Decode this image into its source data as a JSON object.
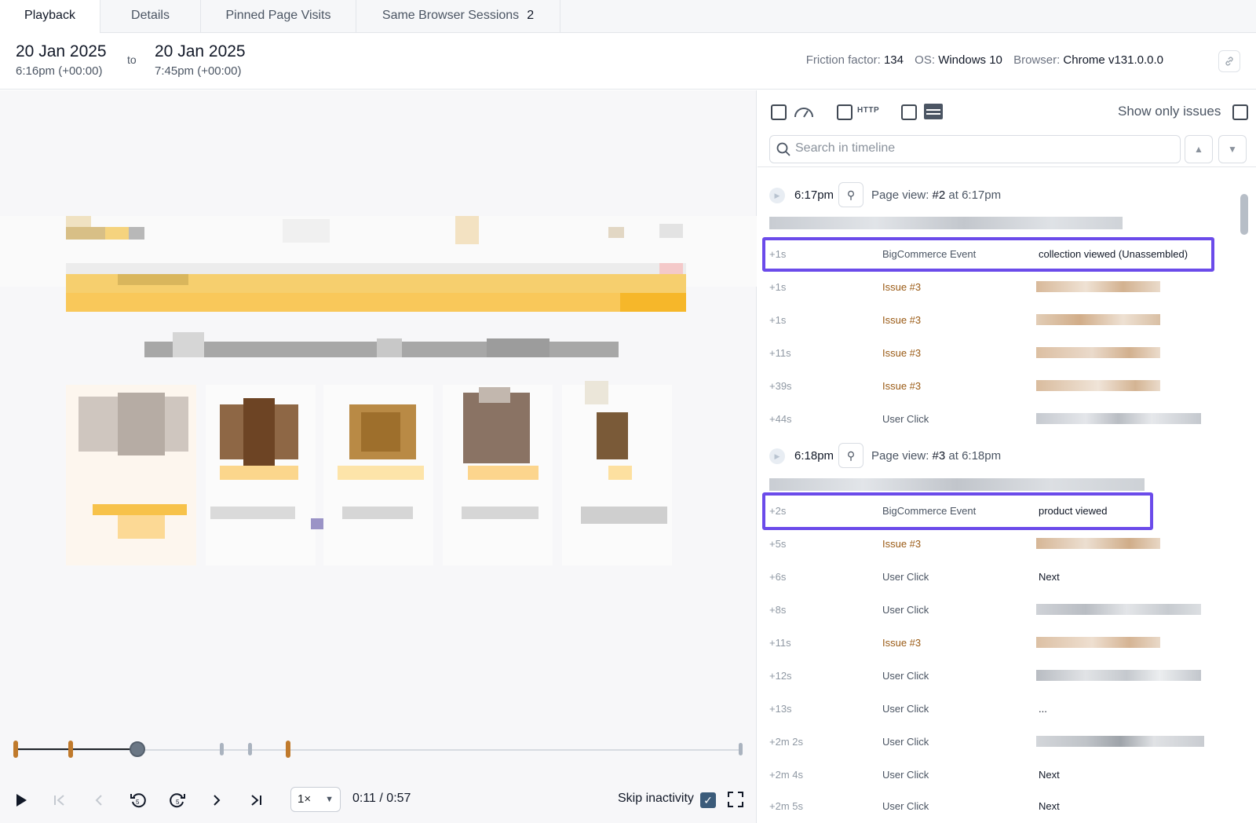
{
  "tabs": [
    {
      "label": "Playback"
    },
    {
      "label": "Details"
    },
    {
      "label": "Pinned Page Visits"
    },
    {
      "label": "Same Browser Sessions",
      "count": "2"
    }
  ],
  "header": {
    "start_date": "20 Jan 2025",
    "start_time": "6:16pm (+00:00)",
    "to": "to",
    "end_date": "20 Jan 2025",
    "end_time": "7:45pm (+00:00)",
    "friction_label": "Friction factor:",
    "friction_value": "134",
    "os_label": "OS:",
    "os_value": "Windows 10",
    "browser_label": "Browser:",
    "browser_value": "Chrome v131.0.0.0"
  },
  "player": {
    "speed": "1×",
    "time": "0:11 / 0:57",
    "skip_inactivity_label": "Skip inactivity",
    "skip_inactivity": true,
    "progress": 0.16
  },
  "panel": {
    "http_label": "HTTP",
    "show_only_issues_label": "Show only issues",
    "search_placeholder": "Search in timeline",
    "page_views": [
      {
        "time": "6:17pm",
        "title": "Page view:",
        "number": "#2",
        "at": "at 6:17pm",
        "rows": [
          {
            "offset": "+1s",
            "type": "BigCommerce Event",
            "value": "collection viewed (Unassembled)",
            "highlight": true
          },
          {
            "offset": "+1s",
            "type": "Issue #3",
            "issue": true
          },
          {
            "offset": "+1s",
            "type": "Issue #3",
            "issue": true
          },
          {
            "offset": "+11s",
            "type": "Issue #3",
            "issue": true
          },
          {
            "offset": "+39s",
            "type": "Issue #3",
            "issue": true
          },
          {
            "offset": "+44s",
            "type": "User Click"
          }
        ]
      },
      {
        "time": "6:18pm",
        "title": "Page view:",
        "number": "#3",
        "at": "at 6:18pm",
        "rows": [
          {
            "offset": "+2s",
            "type": "BigCommerce Event",
            "value": "product viewed",
            "highlight": true
          },
          {
            "offset": "+5s",
            "type": "Issue #3",
            "issue": true
          },
          {
            "offset": "+6s",
            "type": "User Click",
            "value": "Next"
          },
          {
            "offset": "+8s",
            "type": "User Click"
          },
          {
            "offset": "+11s",
            "type": "Issue #3",
            "issue": true
          },
          {
            "offset": "+12s",
            "type": "User Click"
          },
          {
            "offset": "+13s",
            "type": "User Click",
            "value": "..."
          },
          {
            "offset": "+2m 2s",
            "type": "User Click"
          },
          {
            "offset": "+2m 4s",
            "type": "User Click",
            "value": "Next"
          },
          {
            "offset": "+2m 5s",
            "type": "User Click",
            "value": "Next"
          }
        ]
      }
    ]
  },
  "colors": {
    "accent_highlight": "#6b4bea",
    "issue": "#9a5a14",
    "marker": "#c07a2c"
  }
}
